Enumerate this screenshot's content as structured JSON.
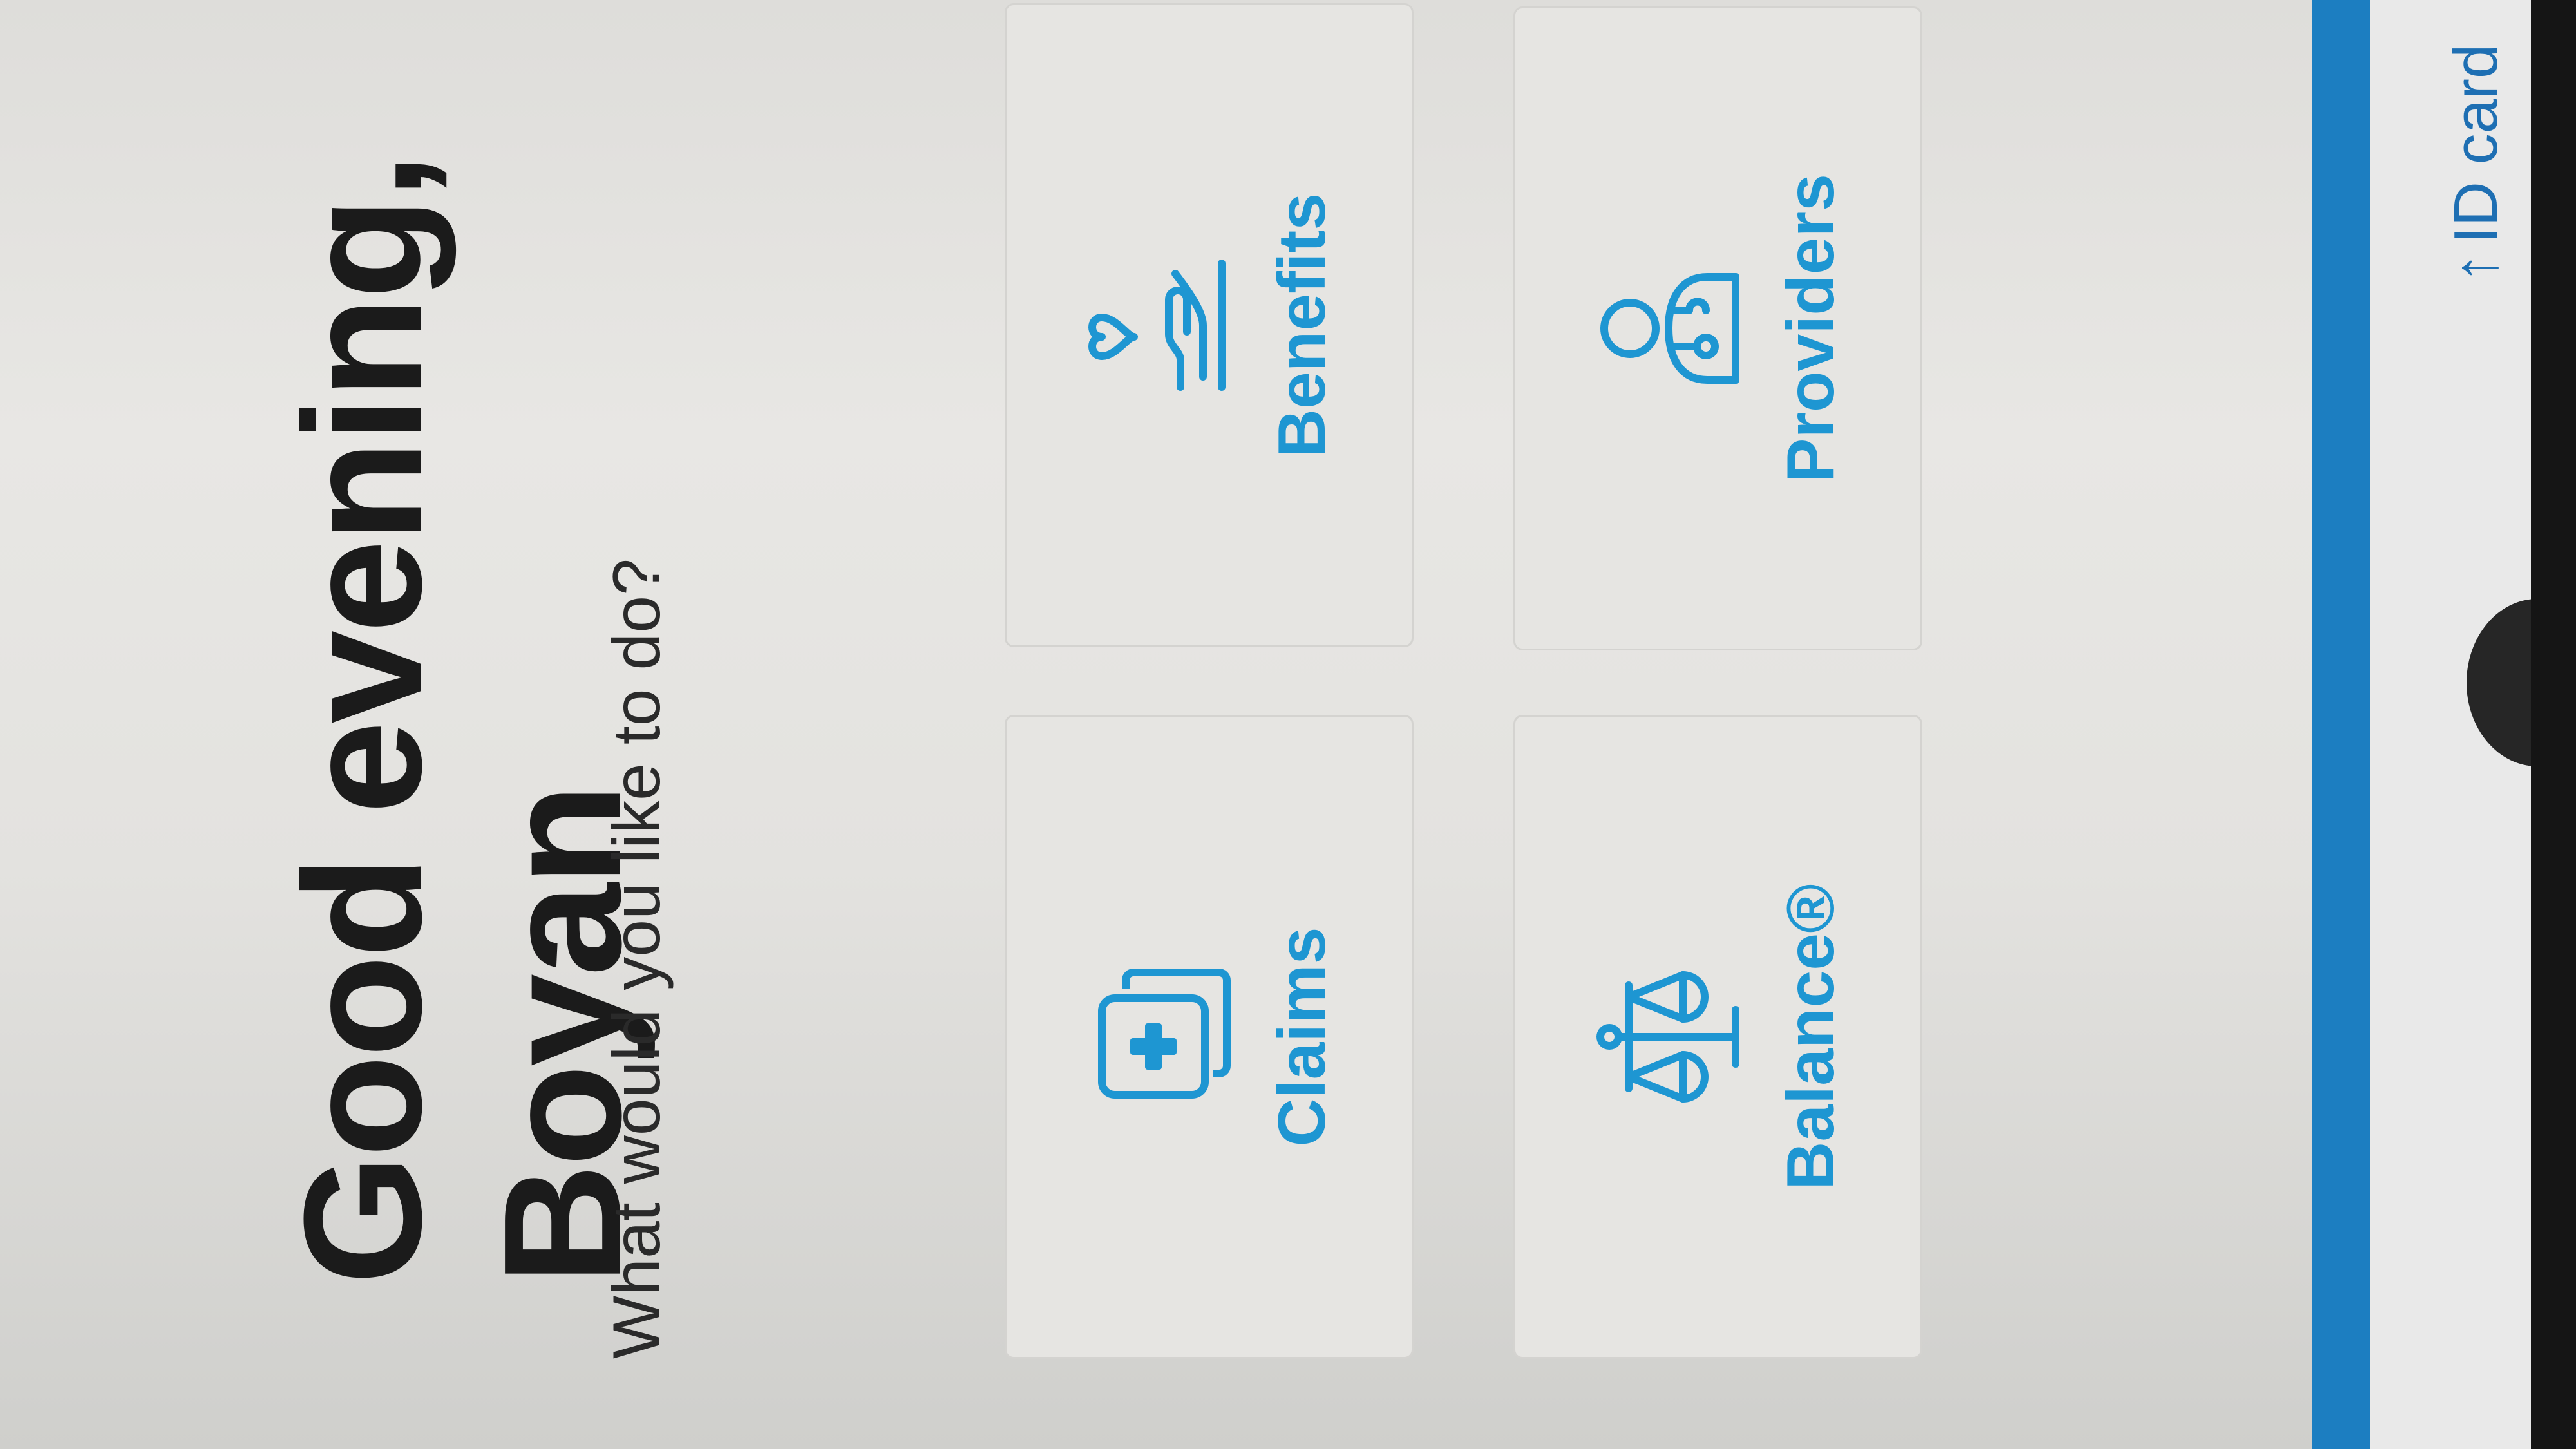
{
  "header": {
    "greeting_line1": "Good evening,",
    "greeting_line2": "Boyan",
    "prompt": "What would you like to do?"
  },
  "actions": [
    {
      "id": "claims",
      "label": "Claims",
      "icon": "medical-documents-icon"
    },
    {
      "id": "benefits",
      "label": "Benefits",
      "icon": "heart-in-hand-icon"
    },
    {
      "id": "balance",
      "label": "Balance®",
      "icon": "balance-scale-icon"
    },
    {
      "id": "providers",
      "label": "Providers",
      "icon": "doctor-icon"
    }
  ],
  "footer": {
    "id_card_label": "ID card",
    "arrow_icon": "arrow-up-icon"
  },
  "colors": {
    "accent": "#1e96d2",
    "footer_bar": "#1c7ec1",
    "text_dark": "#1b1b1b"
  }
}
